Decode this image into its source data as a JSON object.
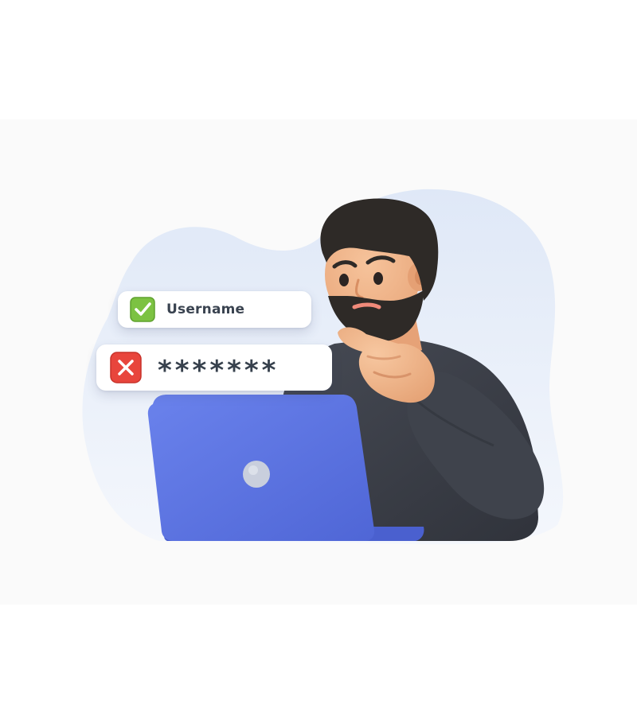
{
  "login_form": {
    "username": {
      "label": "Username",
      "status": "valid",
      "status_icon": "checkmark-icon",
      "status_color": "#7cc242"
    },
    "password": {
      "value": "*******",
      "status": "invalid",
      "status_icon": "cross-icon",
      "status_color": "#e8453c"
    }
  },
  "illustration": {
    "figure": "bearded man thinking at laptop",
    "background_blob_color": "#e5ecf8",
    "laptop_color": "#5b74e3",
    "sweater_color": "#3b3f48",
    "skin_color": "#f0b88e",
    "hair_color": "#2e2a27"
  }
}
